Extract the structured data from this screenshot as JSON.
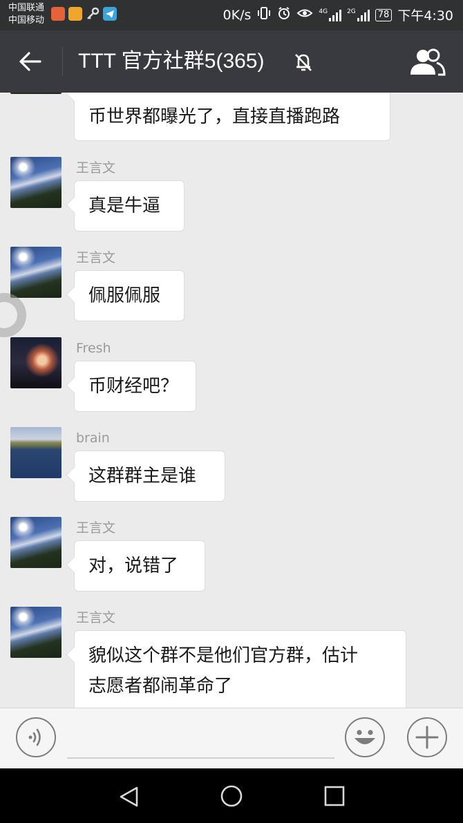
{
  "status_bar": {
    "carrier_1": "中国联通",
    "carrier_2": "中国移动",
    "speed": "0K/s",
    "network_1": "4G",
    "network_2": "2G",
    "battery": "78",
    "time": "下午4:30"
  },
  "header": {
    "title": "TTT 官方社群5(365)",
    "back_icon": "back-arrow-icon",
    "mute_icon": "bell-off-icon",
    "members_icon": "group-members-icon"
  },
  "messages": [
    {
      "sender": "",
      "text": "币世界都曝光了，直接直播跑路",
      "avatar": "sky"
    },
    {
      "sender": "王言文",
      "text": "真是牛逼",
      "avatar": "sky"
    },
    {
      "sender": "王言文",
      "text": "佩服佩服",
      "avatar": "sky"
    },
    {
      "sender": "Fresh",
      "text": "币财经吧？",
      "avatar": "night"
    },
    {
      "sender": "brain",
      "text": "这群群主是谁",
      "avatar": "lake"
    },
    {
      "sender": "王言文",
      "text": "对，说错了",
      "avatar": "sky"
    },
    {
      "sender": "王言文",
      "text_line1": "貌似这个群不是他们官方群，估计",
      "text_line2": "志愿者都闹革命了",
      "avatar": "sky"
    }
  ],
  "input_bar": {
    "voice_icon": "voice-icon",
    "emoji_icon": "emoji-icon",
    "plus_icon": "plus-icon",
    "message_value": ""
  },
  "system_nav": {
    "back_icon": "triangle-back-icon",
    "home_icon": "circle-home-icon",
    "recents_icon": "square-recents-icon"
  }
}
